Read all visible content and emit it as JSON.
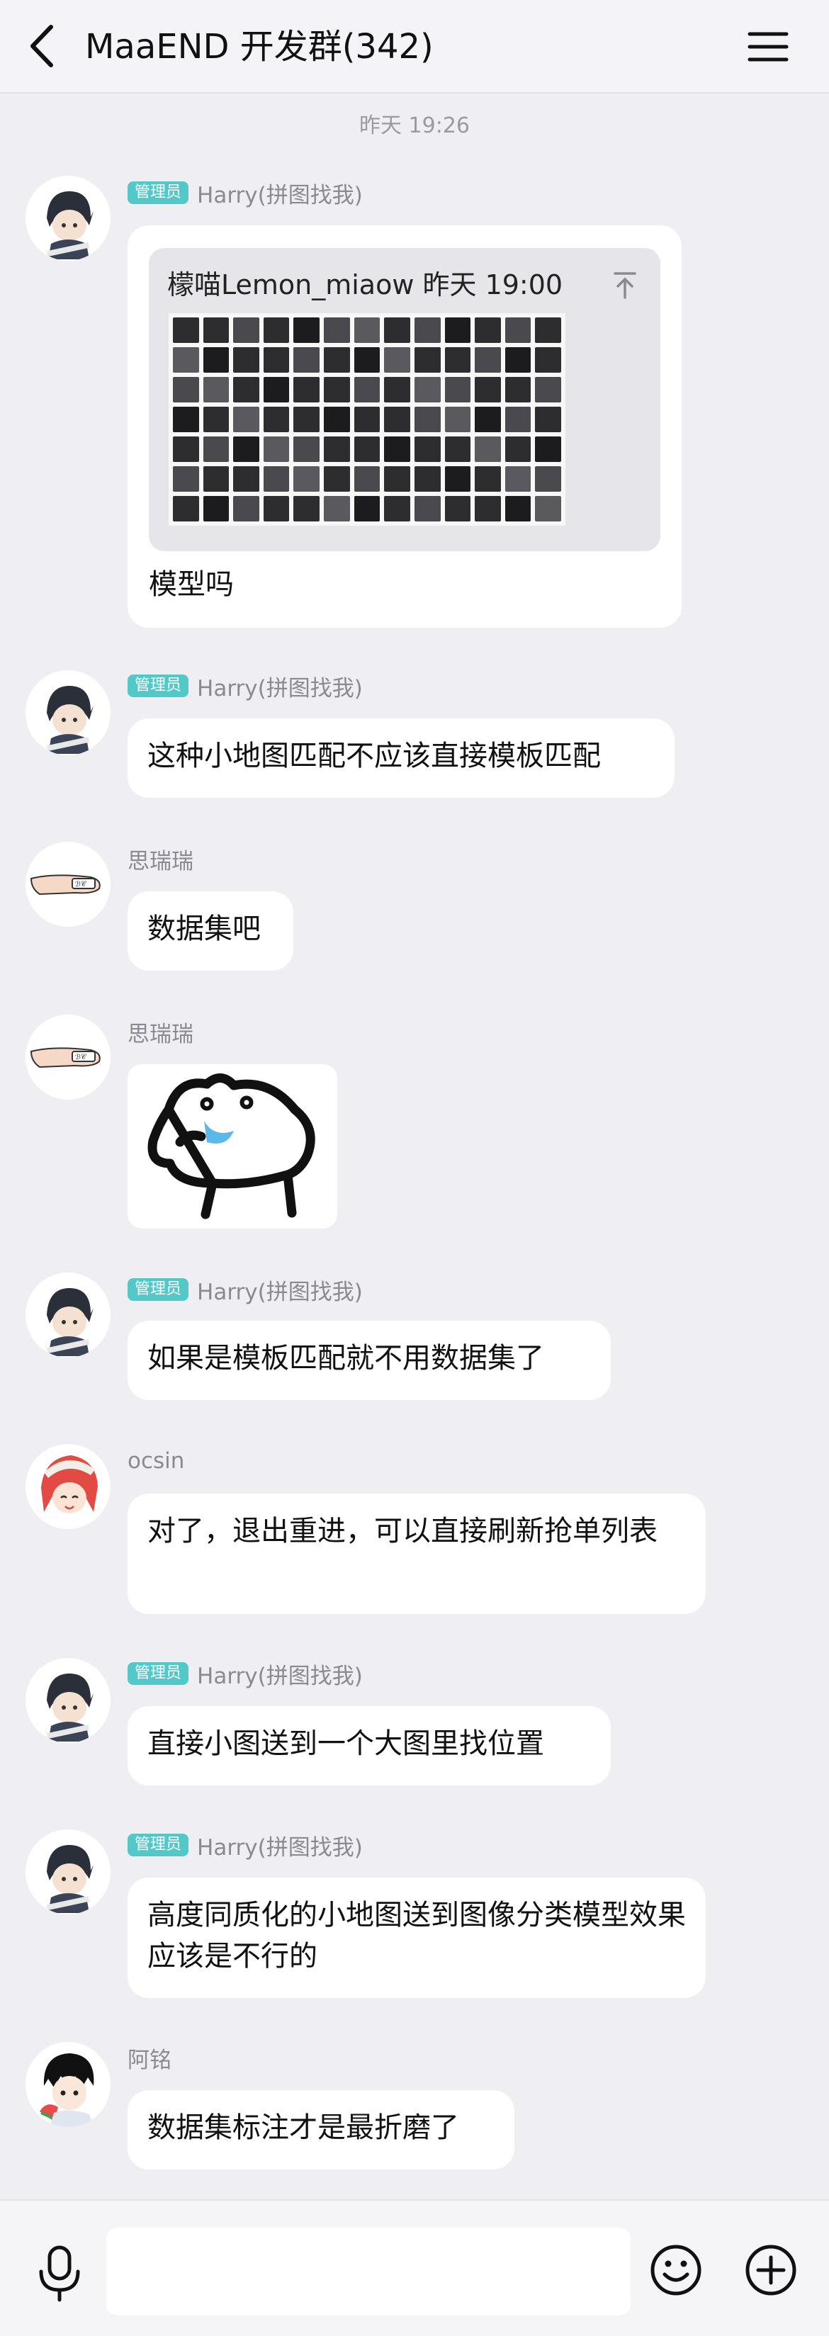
{
  "header": {
    "title": "MaaEND 开发群(342)"
  },
  "timestamp": "昨天 19:26",
  "admin_badge": "管理员",
  "messages": [
    {
      "sender": "Harry(拼图找我)",
      "admin": true,
      "avatar": "harry-avatar",
      "quote": {
        "author_time": "檬喵Lemon_miaow 昨天 19:00",
        "image": "screenshot-thumbnail-grid"
      },
      "text": "模型吗"
    },
    {
      "sender": "Harry(拼图找我)",
      "admin": true,
      "avatar": "harry-avatar",
      "text": "这种小地图匹配不应该直接模板匹配"
    },
    {
      "sender": "思瑞瑞",
      "admin": false,
      "avatar": "hand-avatar",
      "text": "数据集吧"
    },
    {
      "sender": "思瑞瑞",
      "admin": false,
      "avatar": "hand-avatar",
      "sticker": "bear-sticker"
    },
    {
      "sender": "Harry(拼图找我)",
      "admin": true,
      "avatar": "harry-avatar",
      "text": "如果是模板匹配就不用数据集了"
    },
    {
      "sender": "ocsin",
      "admin": false,
      "avatar": "ocsin-avatar",
      "text": "对了，退出重进，可以直接刷新抢单列表"
    },
    {
      "sender": "Harry(拼图找我)",
      "admin": true,
      "avatar": "harry-avatar",
      "text": "直接小图送到一个大图里找位置"
    },
    {
      "sender": "Harry(拼图找我)",
      "admin": true,
      "avatar": "harry-avatar",
      "text": "高度同质化的小地图送到图像分类模型效果应该是不行的"
    },
    {
      "sender": "阿铭",
      "admin": false,
      "avatar": "aming-avatar",
      "text": "数据集标注才是最折磨了"
    }
  ],
  "input": {
    "value": ""
  },
  "colors": {
    "background": "#eeeef3",
    "badge": "#52c8c8",
    "bubble": "#ffffff",
    "meta_text": "#8a8a92"
  }
}
